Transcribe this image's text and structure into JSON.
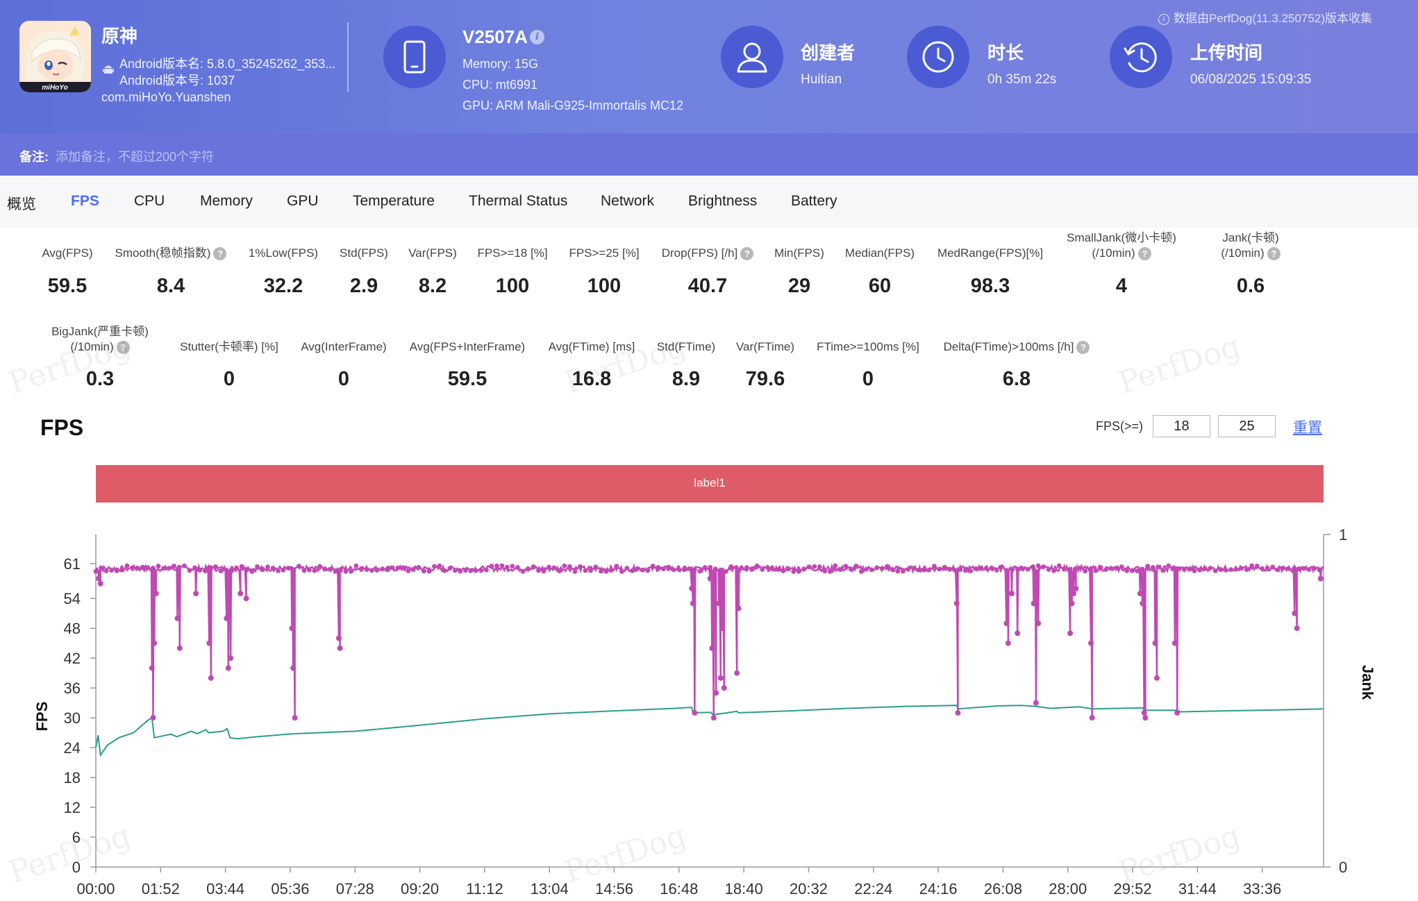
{
  "app": {
    "name": "原神",
    "icon_text": "miHoYo",
    "version_name": "Android版本名: 5.8.0_35245262_353...",
    "version_code": "Android版本号: 1037",
    "package": "com.miHoYo.Yuanshen"
  },
  "device": {
    "model": "V2507A",
    "memory": "Memory: 15G",
    "cpu": "CPU: mt6991",
    "gpu": "GPU: ARM Mali-G925-Immortalis MC12"
  },
  "creator": {
    "title": "创建者",
    "value": "Huitian"
  },
  "duration": {
    "title": "时长",
    "value": "0h 35m 22s"
  },
  "upload": {
    "title": "上传时间",
    "value": "06/08/2025 15:09:35"
  },
  "collect_note": "数据由PerfDog(11.3.250752)版本收集",
  "notes": {
    "label": "备注:",
    "placeholder": "添加备注，不超过200个字符"
  },
  "tabs": [
    "概览",
    "FPS",
    "CPU",
    "Memory",
    "GPU",
    "Temperature",
    "Thermal Status",
    "Network",
    "Brightness",
    "Battery"
  ],
  "active_tab": "FPS",
  "stats_row1": [
    {
      "label": "Avg(FPS)",
      "value": "59.5"
    },
    {
      "label": "Smooth(稳帧指数)",
      "value": "8.4",
      "help": true
    },
    {
      "label": "1%Low(FPS)",
      "value": "32.2"
    },
    {
      "label": "Std(FPS)",
      "value": "2.9"
    },
    {
      "label": "Var(FPS)",
      "value": "8.2"
    },
    {
      "label": "FPS>=18 [%]",
      "value": "100"
    },
    {
      "label": "FPS>=25 [%]",
      "value": "100"
    },
    {
      "label": "Drop(FPS) [/h]",
      "value": "40.7",
      "help": true
    },
    {
      "label": "Min(FPS)",
      "value": "29"
    },
    {
      "label": "Median(FPS)",
      "value": "60"
    },
    {
      "label": "MedRange(FPS)[%]",
      "value": "98.3"
    },
    {
      "label": "SmallJank(微小卡顿)",
      "label2": "(/10min)",
      "value": "4",
      "help": true
    },
    {
      "label": "Jank(卡顿)",
      "label2": "(/10min)",
      "value": "0.6",
      "help": true
    }
  ],
  "stats_row2": [
    {
      "label": "BigJank(严重卡顿)",
      "label2": "(/10min)",
      "value": "0.3",
      "help": true
    },
    {
      "label": "Stutter(卡顿率) [%]",
      "value": "0"
    },
    {
      "label": "Avg(InterFrame)",
      "value": "0"
    },
    {
      "label": "Avg(FPS+InterFrame)",
      "value": "59.5"
    },
    {
      "label": "Avg(FTime) [ms]",
      "value": "16.8"
    },
    {
      "label": "Std(FTime)",
      "value": "8.9"
    },
    {
      "label": "Var(FTime)",
      "value": "79.6"
    },
    {
      "label": "FTime>=100ms [%]",
      "value": "0"
    },
    {
      "label": "Delta(FTime)>100ms [/h]",
      "value": "6.8",
      "help": true
    }
  ],
  "watermark_text": "PerfDog",
  "fps_section": {
    "title": "FPS",
    "threshold_label": "FPS(>=)",
    "threshold_1": "18",
    "threshold_2": "25",
    "reset_label": "重置",
    "label_bar": "label1"
  },
  "chart_data": {
    "type": "line",
    "ylabel": "FPS",
    "y2label": "Jank",
    "yticks": [
      0,
      6,
      12,
      18,
      24,
      30,
      36,
      42,
      48,
      54,
      61
    ],
    "y2ticks": [
      0,
      1
    ],
    "ylim": [
      0,
      61
    ],
    "x_ticks": [
      "00:00",
      "01:52",
      "03:44",
      "05:36",
      "07:28",
      "09:20",
      "11:12",
      "13:04",
      "14:56",
      "16:48",
      "18:40",
      "20:32",
      "22:24",
      "24:16",
      "26:08",
      "28:00",
      "29:52",
      "31:44",
      "33:36"
    ],
    "x_tick_seconds": [
      0,
      112,
      224,
      336,
      448,
      560,
      672,
      784,
      896,
      1008,
      1120,
      1232,
      1344,
      1456,
      1568,
      1680,
      1792,
      1904,
      2016
    ],
    "duration_s": 2122,
    "series": [
      {
        "color": "#c049b3",
        "baseline_fps": 60,
        "drops": [
          [
            5,
            58
          ],
          [
            8,
            57
          ],
          [
            97,
            40
          ],
          [
            99,
            30
          ],
          [
            101,
            45
          ],
          [
            104,
            55
          ],
          [
            141,
            50
          ],
          [
            145,
            44
          ],
          [
            173,
            55
          ],
          [
            196,
            45
          ],
          [
            199,
            38
          ],
          [
            226,
            50
          ],
          [
            229,
            40
          ],
          [
            233,
            42
          ],
          [
            250,
            55
          ],
          [
            260,
            54
          ],
          [
            339,
            48
          ],
          [
            341,
            40
          ],
          [
            344,
            30
          ],
          [
            420,
            46
          ],
          [
            422,
            44
          ],
          [
            1030,
            56
          ],
          [
            1032,
            53
          ],
          [
            1035,
            31
          ],
          [
            1062,
            58
          ],
          [
            1065,
            44
          ],
          [
            1068,
            30
          ],
          [
            1072,
            35
          ],
          [
            1077,
            53
          ],
          [
            1080,
            38
          ],
          [
            1083,
            48
          ],
          [
            1086,
            36
          ],
          [
            1108,
            39
          ],
          [
            1111,
            52
          ],
          [
            1488,
            53
          ],
          [
            1490,
            31
          ],
          [
            1574,
            49
          ],
          [
            1577,
            45
          ],
          [
            1583,
            55
          ],
          [
            1593,
            47
          ],
          [
            1621,
            53
          ],
          [
            1625,
            33
          ],
          [
            1629,
            49
          ],
          [
            1684,
            47
          ],
          [
            1687,
            53
          ],
          [
            1690,
            55
          ],
          [
            1694,
            56
          ],
          [
            1720,
            45
          ],
          [
            1722,
            30
          ],
          [
            1805,
            55
          ],
          [
            1809,
            53
          ],
          [
            1812,
            31
          ],
          [
            1814,
            30
          ],
          [
            1831,
            45
          ],
          [
            1834,
            38
          ],
          [
            1865,
            45
          ],
          [
            1869,
            31
          ],
          [
            2072,
            51
          ],
          [
            2076,
            48
          ],
          [
            2117,
            58
          ]
        ]
      },
      {
        "color": "#2a9d8f",
        "points": [
          [
            0,
            24
          ],
          [
            4,
            26.5
          ],
          [
            8,
            22.5
          ],
          [
            20,
            24.5
          ],
          [
            40,
            26
          ],
          [
            65,
            27
          ],
          [
            90,
            29.5
          ],
          [
            97,
            30
          ],
          [
            101,
            26
          ],
          [
            130,
            26.7
          ],
          [
            140,
            26.2
          ],
          [
            165,
            27.3
          ],
          [
            175,
            26.8
          ],
          [
            190,
            27.6
          ],
          [
            195,
            27
          ],
          [
            220,
            27.3
          ],
          [
            227,
            27.8
          ],
          [
            232,
            26
          ],
          [
            245,
            25.8
          ],
          [
            280,
            26.2
          ],
          [
            330,
            26.7
          ],
          [
            345,
            26.8
          ],
          [
            450,
            27.3
          ],
          [
            560,
            28.5
          ],
          [
            672,
            29.8
          ],
          [
            784,
            30.8
          ],
          [
            896,
            31.4
          ],
          [
            1000,
            31.9
          ],
          [
            1030,
            32.1
          ],
          [
            1032,
            31
          ],
          [
            1063,
            31.1
          ],
          [
            1067,
            30.6
          ],
          [
            1108,
            31.3
          ],
          [
            1111,
            31
          ],
          [
            1200,
            31.4
          ],
          [
            1300,
            31.9
          ],
          [
            1400,
            32.3
          ],
          [
            1488,
            32.5
          ],
          [
            1490,
            31.8
          ],
          [
            1560,
            32.4
          ],
          [
            1600,
            32.5
          ],
          [
            1625,
            32.3
          ],
          [
            1650,
            31.9
          ],
          [
            1700,
            32.2
          ],
          [
            1722,
            31.8
          ],
          [
            1810,
            32
          ],
          [
            1812,
            31.5
          ],
          [
            1869,
            31.5
          ],
          [
            1875,
            31.2
          ],
          [
            1950,
            31.4
          ],
          [
            2050,
            31.6
          ],
          [
            2122,
            31.8
          ]
        ]
      }
    ]
  }
}
